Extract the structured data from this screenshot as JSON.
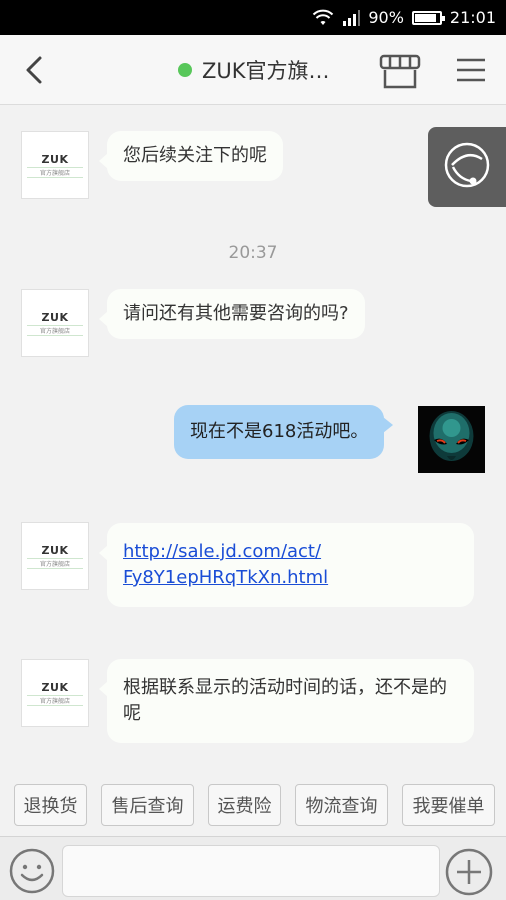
{
  "status_bar": {
    "battery_percent": "90%",
    "time": "21:01",
    "battery_level": 0.9
  },
  "header": {
    "title": "ZUK官方旗…",
    "online_color": "#58c75a"
  },
  "shop": {
    "avatar_logo": "ZUK",
    "avatar_sub": "官方旗舰店"
  },
  "messages": [
    {
      "from": "shop",
      "text": "您后续关注下的呢"
    },
    {
      "type": "timestamp",
      "text": "20:37"
    },
    {
      "from": "shop",
      "text": "请问还有其他需要咨询的吗?"
    },
    {
      "from": "user",
      "text": "现在不是618活动吧。"
    },
    {
      "from": "shop",
      "text": "http://sale.jd.com/act/Fy8Y1epHRqTkXn.html",
      "text_line1": "http://sale.jd.com/act/",
      "text_line2": "Fy8Y1epHRqTkXn.html"
    },
    {
      "from": "shop",
      "text": "根据联系显示的活动时间的话，还不是的呢"
    }
  ],
  "quick_actions": [
    "退换货",
    "售后查询",
    "运费险",
    "物流查询",
    "我要催单"
  ],
  "input": {
    "placeholder": "",
    "value": ""
  },
  "colors": {
    "incoming_bubble": "#fbfdf9",
    "outgoing_bubble": "#a7d2f5",
    "link": "#1a4dd6"
  }
}
